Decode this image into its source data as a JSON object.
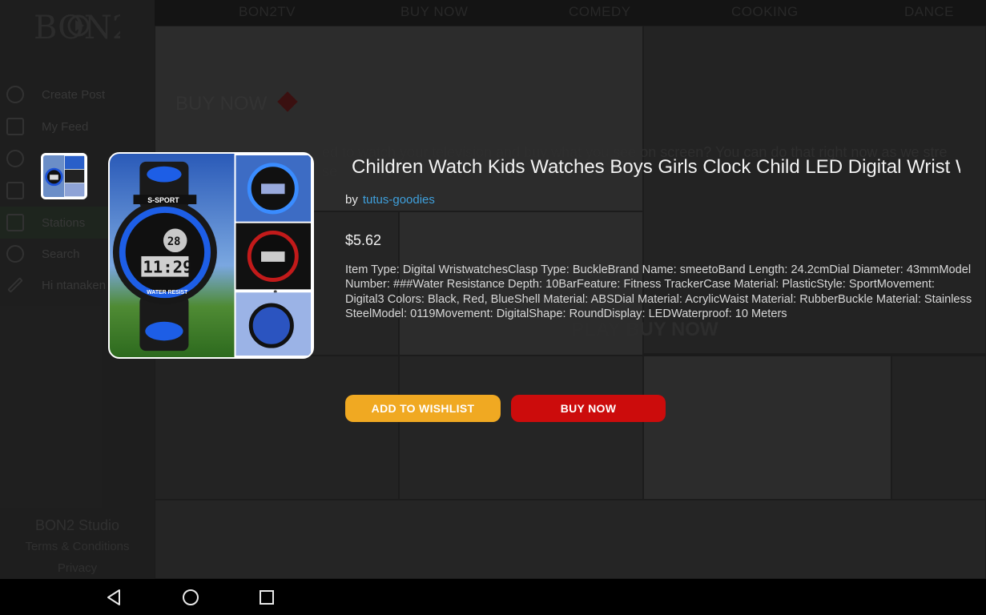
{
  "background": {
    "logo_text": "BON2",
    "sidebar": [
      {
        "label": "Create Post",
        "icon": "plus-circle-icon"
      },
      {
        "label": "My Feed",
        "icon": "feed-icon"
      },
      {
        "label": "",
        "icon": "compass-icon"
      },
      {
        "label": "",
        "icon": "tv-icon"
      },
      {
        "label": "Stations",
        "icon": "stations-icon"
      },
      {
        "label": "Search",
        "icon": "search-icon"
      },
      {
        "label": "Hi ntanaken",
        "icon": "pencil-icon"
      }
    ],
    "footer": {
      "studio": "BON2 Studio",
      "terms": "Terms & Conditions",
      "privacy": "Privacy"
    },
    "top_nav": [
      "BON2TV",
      "BUY NOW",
      "COMEDY",
      "COOKING",
      "DANCE"
    ],
    "hero_title": "BUY NOW",
    "hero_text": "ed to watch your television and buy what you see on screen? You can do that right now as we stre",
    "hero_text2": "se",
    "play_banner": "PLAY BUY NOW"
  },
  "product": {
    "title": "Children Watch Kids Watches Boys Girls Clock Child LED Digital Wrist Watch",
    "by_label": "by",
    "seller": "tutus-goodies",
    "price": "$5.62",
    "description": "Item Type: Digital WristwatchesClasp Type: BuckleBrand Name: smeetoBand Length: 24.2cmDial Diameter: 43mmModel Number: ###Water Resistance Depth: 10BarFeature: Fitness TrackerCase Material: PlasticStyle: SportMovement: Digital3 Colors: Black, Red, BlueShell Material: ABSDial Material: AcrylicWaist Material: RubberBuckle Material: Stainless SteelModel: 0119Movement: DigitalShape: RoundDisplay: LEDWaterproof: 10 Meters",
    "image_brand": "S-SPORT",
    "image_time": "11:29",
    "image_number": "28",
    "image_strap_text": "WATER RESIST",
    "wishlist_label": "ADD TO WISHLIST",
    "buy_label": "BUY NOW",
    "colors": {
      "wishlist": "#f0a922",
      "buy": "#cc0c0c",
      "seller_link": "#3fa0dc"
    }
  },
  "system_nav": {
    "back": "back-icon",
    "home": "home-icon",
    "recents": "recents-icon"
  }
}
